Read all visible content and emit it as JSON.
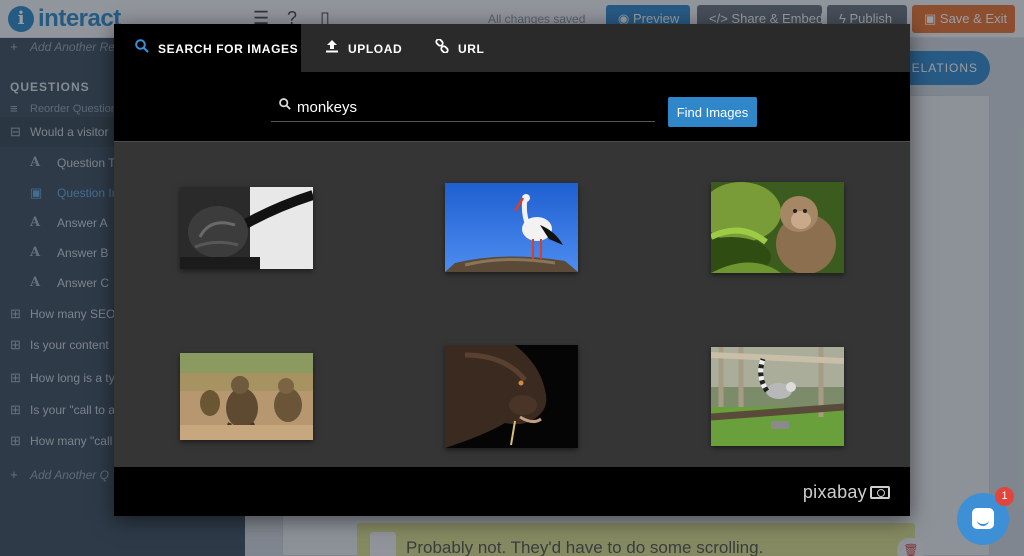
{
  "app": {
    "logo_text": "interact",
    "save_status": "All changes saved",
    "buttons": {
      "preview": "Preview",
      "share": "Share & Embed",
      "publish": "Publish",
      "save_exit": "Save & Exit"
    },
    "relations_button": "RELATIONS"
  },
  "sidebar": {
    "add_result": "Add Another Re",
    "section_title": "QUESTIONS",
    "reorder": "Reorder Questions",
    "active_question": "Would a visitor",
    "sub_items": [
      {
        "label": "Question Ti",
        "icon": "A"
      },
      {
        "label": "Question Im",
        "icon": "image"
      },
      {
        "label": "Answer A",
        "icon": "A"
      },
      {
        "label": "Answer B",
        "icon": "A"
      },
      {
        "label": "Answer C",
        "icon": "A"
      }
    ],
    "questions": [
      "How many SEO",
      "Is your content",
      "How long is a ty",
      "Is your \"call to a",
      "How many \"call"
    ],
    "add_question": "Add Another Q"
  },
  "editor": {
    "answer_text": "Probably not. They'd have to do some scrolling."
  },
  "modal": {
    "tabs": [
      {
        "label": "SEARCH FOR IMAGES",
        "icon": "search-icon",
        "active": true
      },
      {
        "label": "UPLOAD",
        "icon": "upload-icon",
        "active": false
      },
      {
        "label": "URL",
        "icon": "link-icon",
        "active": false
      }
    ],
    "search": {
      "value": "monkeys",
      "button": "Find Images"
    },
    "results": [
      {
        "subject": "black and white gorilla hand gripping a rope"
      },
      {
        "subject": "stork standing on a nest against blue sky"
      },
      {
        "subject": "macaque sitting among green leaves"
      },
      {
        "subject": "baboons walking on dusty ground"
      },
      {
        "subject": "gorilla head in profile on black background"
      },
      {
        "subject": "ring-tailed lemur on a wooden climbing frame"
      }
    ],
    "footer_brand": "pixabay"
  },
  "chat": {
    "badge_count": "1"
  },
  "colors": {
    "accent_blue": "#2f86c8",
    "save_orange": "#e6702f",
    "sidebar": "#3b4c5b",
    "modal_bg": "#353535"
  }
}
